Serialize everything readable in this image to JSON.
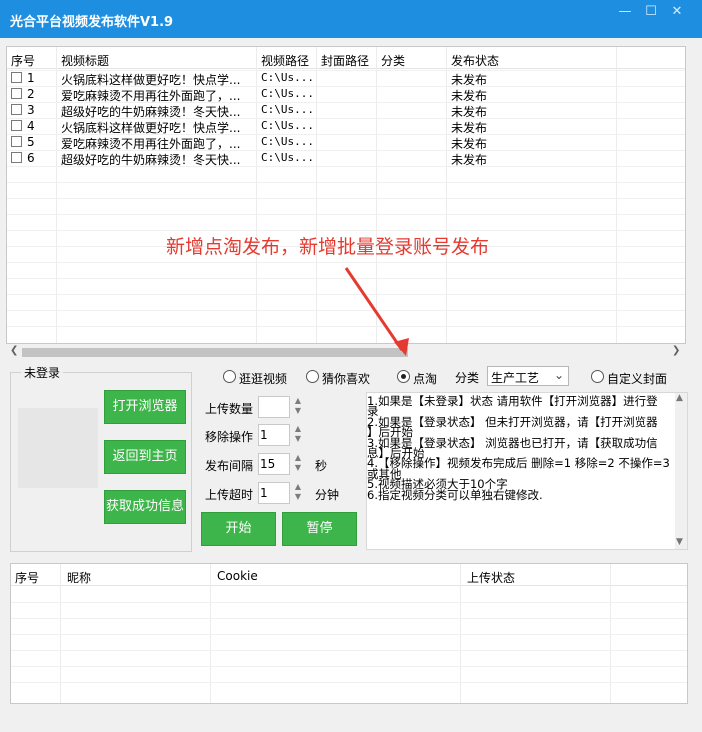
{
  "window": {
    "title": "光合平台视频发布软件V1.9",
    "minimize_label": "—",
    "maximize_label": "☐",
    "close_label": "✕"
  },
  "video_table": {
    "columns": [
      "序号",
      "视频标题",
      "视频路径",
      "封面路径",
      "分类",
      "发布状态"
    ],
    "rows": [
      {
        "index": "1",
        "title": "火锅底料这样做更好吃！快点学...",
        "path": "C:\\Us...",
        "cover": "",
        "category": "",
        "status": "未发布"
      },
      {
        "index": "2",
        "title": "爱吃麻辣烫不用再往外面跑了，...",
        "path": "C:\\Us...",
        "cover": "",
        "category": "",
        "status": "未发布"
      },
      {
        "index": "3",
        "title": "超级好吃的牛奶麻辣烫！冬天快...",
        "path": "C:\\Us...",
        "cover": "",
        "category": "",
        "status": "未发布"
      },
      {
        "index": "4",
        "title": "火锅底料这样做更好吃！快点学...",
        "path": "C:\\Us...",
        "cover": "",
        "category": "",
        "status": "未发布"
      },
      {
        "index": "5",
        "title": "爱吃麻辣烫不用再往外面跑了，...",
        "path": "C:\\Us...",
        "cover": "",
        "category": "",
        "status": "未发布"
      },
      {
        "index": "6",
        "title": "超级好吃的牛奶麻辣烫！冬天快...",
        "path": "C:\\Us...",
        "cover": "",
        "category": "",
        "status": "未发布"
      }
    ]
  },
  "annotation": "新增点淘发布，新增批量登录账号发布",
  "platforms": [
    {
      "label": "逛逛视频",
      "selected": false
    },
    {
      "label": "猜你喜欢",
      "selected": false
    },
    {
      "label": "点淘",
      "selected": true
    }
  ],
  "category": {
    "label": "分类",
    "value": "生产工艺"
  },
  "custom_cover_label": "自定义封面",
  "login_panel": {
    "status": "未登录",
    "open_browser": "打开浏览器",
    "back_home": "返回到主页",
    "get_info": "获取成功信息"
  },
  "settings": {
    "upload_count": {
      "label": "上传数量",
      "value": ""
    },
    "move_op": {
      "label": "移除操作",
      "value": "1"
    },
    "interval": {
      "label": "发布间隔",
      "value": "15",
      "unit": "秒"
    },
    "timeout": {
      "label": "上传超时",
      "value": "1",
      "unit": "分钟"
    }
  },
  "start_button": "开始",
  "pause_button": "暂停",
  "instructions": [
    "1.如果是【未登录】状态 请用软件【打开浏览器】进行登",
    "录",
    "2.如果是【登录状态】 但未打开浏览器，请【打开浏览器",
    "】后开始",
    "3.如果是【登录状态】 浏览器也已打开，请【获取成功信",
    "息】后开始",
    "4.【移除操作】视频发布完成后 删除=1 移除=2 不操作=3",
    "或其他",
    "5.视频描述必须大于10个字",
    "6.指定视频分类可以单独右键修改."
  ],
  "account_table": {
    "columns": [
      "序号",
      "昵称",
      "Cookie",
      "上传状态"
    ]
  }
}
